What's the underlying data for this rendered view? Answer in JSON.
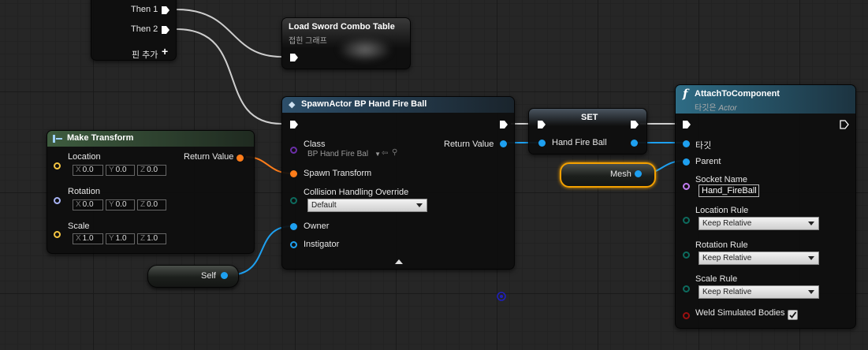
{
  "sequence": {
    "then1": "Then 1",
    "then2": "Then 2",
    "add_pin": "핀 추가"
  },
  "load_sword": {
    "title": "Load Sword Combo Table",
    "subtitle": "접힌 그래프"
  },
  "make_transform": {
    "title": "Make Transform",
    "location": "Location",
    "rotation": "Rotation",
    "scale": "Scale",
    "return_value": "Return Value",
    "location_xyz": {
      "x": "0.0",
      "y": "0.0",
      "z": "0.0"
    },
    "rotation_xyz": {
      "x": "0.0",
      "y": "0.0",
      "z": "0.0"
    },
    "scale_xyz": {
      "x": "1.0",
      "y": "1.0",
      "z": "1.0"
    },
    "axis": {
      "x": "X",
      "y": "Y",
      "z": "Z"
    }
  },
  "spawn_actor": {
    "title": "SpawnActor BP Hand Fire Ball",
    "class_label": "Class",
    "class_value": "BP Hand Fire Bal",
    "spawn_transform": "Spawn Transform",
    "collision_label": "Collision Handling Override",
    "collision_value": "Default",
    "owner": "Owner",
    "instigator": "Instigator",
    "return_value": "Return Value"
  },
  "set_node": {
    "title": "SET",
    "variable": "Hand Fire Ball"
  },
  "self_node": {
    "label": "Self"
  },
  "mesh_node": {
    "label": "Mesh"
  },
  "attach": {
    "icon": "f",
    "title": "AttachToComponent",
    "subtitle_prefix": "타깃은 ",
    "subtitle_target": "Actor",
    "target": "타깃",
    "parent": "Parent",
    "socket_label": "Socket Name",
    "socket_value": "Hand_FireBall",
    "location_rule": "Location Rule",
    "rotation_rule": "Rotation Rule",
    "scale_rule": "Scale Rule",
    "rule_value": "Keep Relative",
    "weld": "Weld Simulated Bodies",
    "weld_checked": true
  },
  "colors": {
    "exec": "#ffffff",
    "transform": "#ff7d1a",
    "vector": "#f5c542",
    "rotator": "#a8b4f5",
    "object": "#1ea0f0",
    "class": "#6b2fa8",
    "byte_enum": "#0d6b5e",
    "name": "#c17bf0",
    "bool": "#9a1010",
    "selection": "#f3a000",
    "spawn_header": "#2d4f6a",
    "attach_header": "#2e6c85",
    "make_header": "#2f4a33"
  },
  "icons": [
    "exec-pin-icon",
    "plus-icon",
    "function-icon",
    "spawn-icon",
    "struct-icon",
    "dropdown-caret-icon",
    "checkmark-icon",
    "expand-arrow-icon",
    "magnifier-icon",
    "browse-arrow-icon"
  ]
}
